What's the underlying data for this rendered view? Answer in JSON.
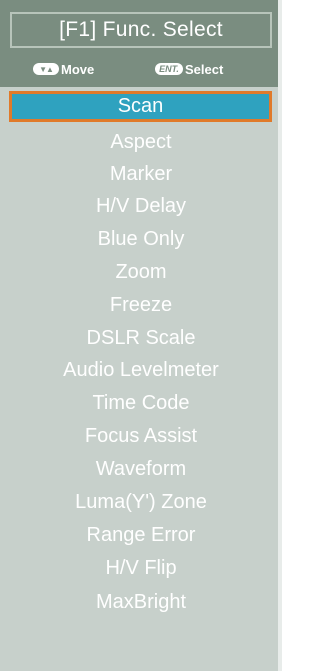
{
  "header": {
    "title": "[F1] Func. Select",
    "hint_move_label": "Move",
    "hint_select_label": "Select",
    "hint_move_key": "▼▲",
    "hint_select_key": "ENT."
  },
  "menu": {
    "selected_index": 0,
    "items": [
      "Scan",
      "Aspect",
      "Marker",
      "H/V Delay",
      "Blue Only",
      "Zoom",
      "Freeze",
      "DSLR Scale",
      "Audio Levelmeter",
      "Time Code",
      "Focus Assist",
      "Waveform",
      "Luma(Y') Zone",
      "Range Error",
      "H/V Flip",
      "MaxBright"
    ]
  },
  "colors": {
    "header_bg": "#7a8d80",
    "list_bg": "#c7d0cb",
    "selected_bg": "#2fa2bf",
    "selected_border": "#e07a2a",
    "text": "#ffffff"
  }
}
